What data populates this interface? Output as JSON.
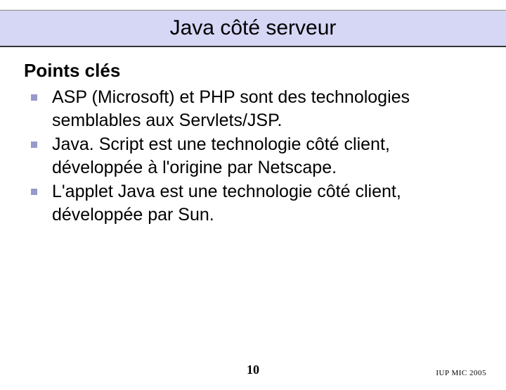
{
  "title": "Java côté serveur",
  "heading": "Points clés",
  "bullets": [
    "ASP (Microsoft) et PHP sont des technologies semblables aux Servlets/JSP.",
    "Java. Script est une technologie côté client, développée à l'origine par Netscape.",
    "L'applet Java est une technologie côté client, développée par Sun."
  ],
  "page_number": "10",
  "footer": "IUP MIC 2005"
}
